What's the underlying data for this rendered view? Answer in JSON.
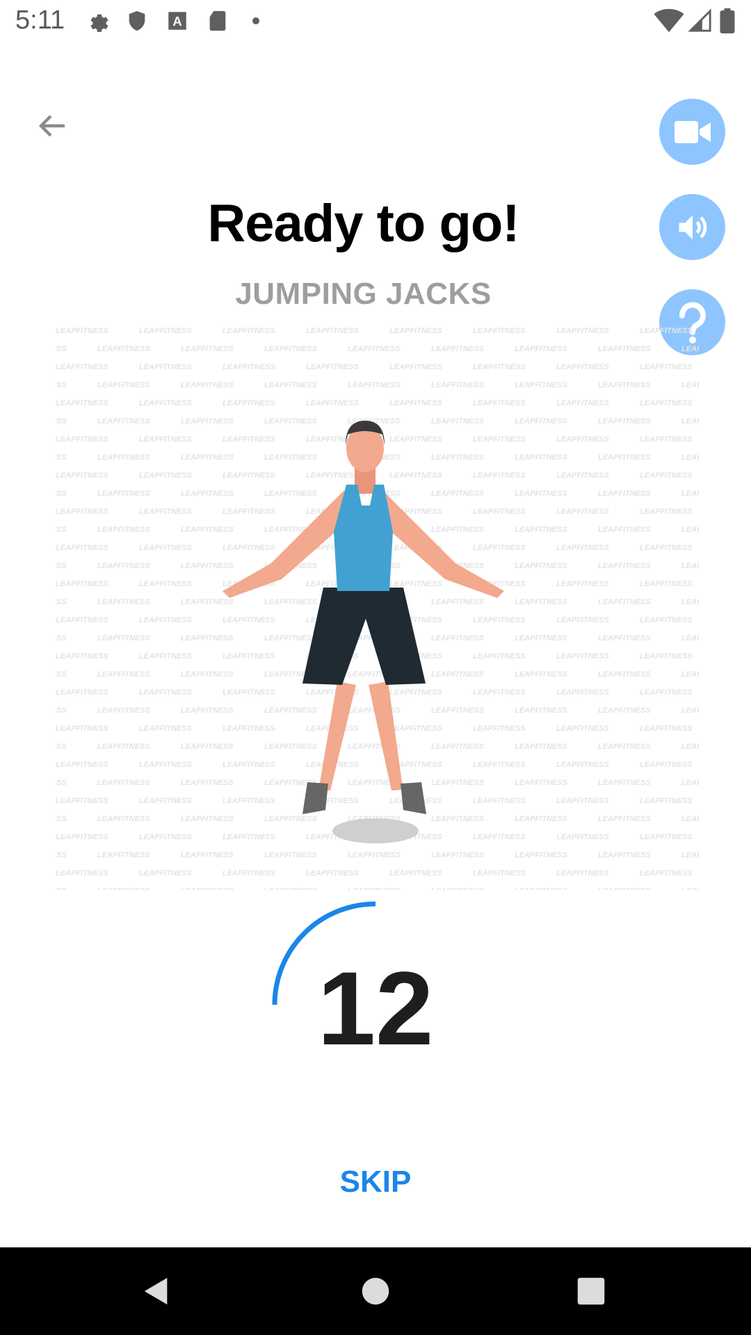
{
  "status_bar": {
    "time": "5:11",
    "icons": [
      "settings-icon",
      "shield-icon",
      "a-badge-icon",
      "sd-card-icon",
      "dot-icon",
      "wifi-icon",
      "signal-icon",
      "battery-icon"
    ]
  },
  "header": {
    "back_icon": "arrow-left-icon",
    "video_icon": "video-camera-icon",
    "sound_icon": "speaker-icon",
    "help_icon": "question-icon"
  },
  "main": {
    "title": "Ready to go!",
    "exercise_name": "JUMPING JACKS",
    "watermark": "LEAPFITNESS",
    "countdown_value": "12",
    "countdown_progress": 0.25,
    "skip_label": "SKIP"
  },
  "colors": {
    "accent_blue": "#1a86ea",
    "round_button_bg": "#8ec5ff",
    "subtitle_gray": "#9e9e9e"
  },
  "nav_bar": {
    "icons": [
      "back-triangle-icon",
      "home-circle-icon",
      "recents-square-icon"
    ]
  }
}
